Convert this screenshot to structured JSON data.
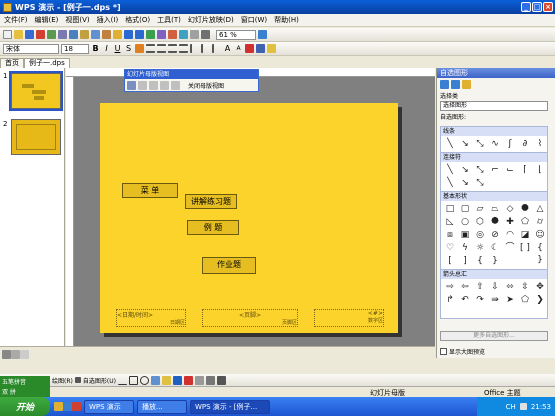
{
  "window": {
    "title": "WPS 演示 - [例子一.dps *]"
  },
  "menu": [
    "文件(F)",
    "编辑(E)",
    "视图(V)",
    "插入(I)",
    "格式(O)",
    "工具(T)",
    "幻灯片放映(D)",
    "窗口(W)",
    "帮助(H)"
  ],
  "format_toolbar": {
    "font": "宋体",
    "size": "18",
    "zoom": "61 %"
  },
  "tabs": {
    "first": "首页",
    "second": "例子一.dps"
  },
  "thumbnails": [
    "1",
    "2"
  ],
  "outline_toolbar": {
    "title": "幻灯片母版视图",
    "close_label": "关闭母版视图"
  },
  "slide": {
    "items": [
      "菜 单",
      "讲解练习题",
      "例 题",
      "作业题"
    ],
    "footer_left": "<日期/时间>",
    "footer_left_sub": "日期区",
    "footer_mid": "<页脚>",
    "footer_mid_sub": "页脚区",
    "footer_right": "<#>",
    "footer_right_sub": "数字区"
  },
  "rightpanel": {
    "title": "自选图形",
    "category_label": "选择类",
    "category_value": "选择图形",
    "shapes_label": "自选图形:",
    "sec_lines": "线条",
    "sec_connectors": "连接符",
    "sec_basic": "基本形状",
    "sec_arrows": "箭头总汇",
    "more_button": "更多自选图形...",
    "checkbox_label": "显示大图预览"
  },
  "status": {
    "left": "",
    "mid": "幻灯片母版",
    "right": "Office 主题"
  },
  "drawbar": {
    "draw_label": "绘图(R)",
    "autoshape_label": "自选图形(U)"
  },
  "taskbar": {
    "start": "开始",
    "tasks": [
      "WPS 演示",
      "播放...",
      "WPS 演示 - [例子..."
    ],
    "clock": "21:53",
    "lang": "CH"
  },
  "greenpanel": {
    "line1": "五笔拼音",
    "line2": "双 拼"
  }
}
